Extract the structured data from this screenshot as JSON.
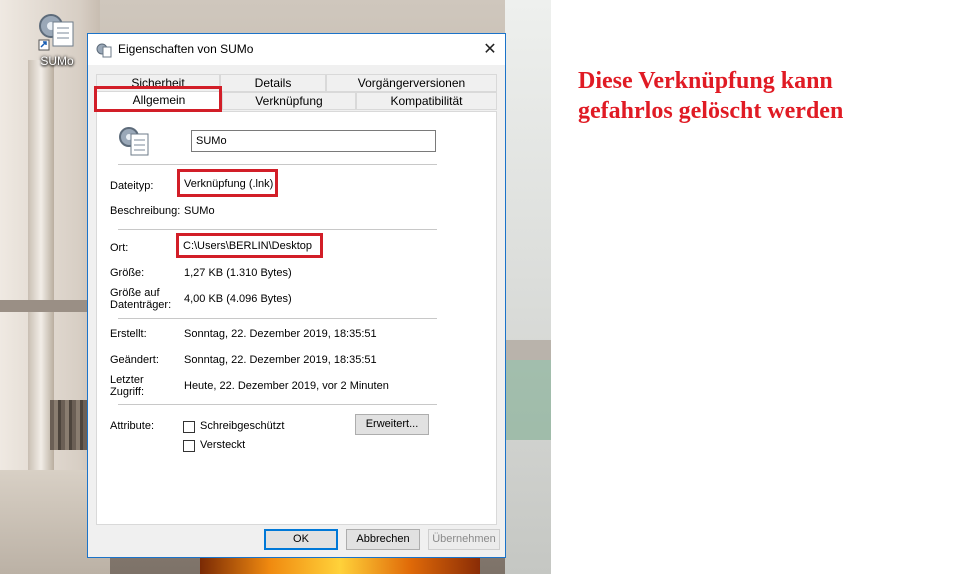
{
  "desktop": {
    "icon_label": "SUMo"
  },
  "dialog": {
    "title": "Eigenschaften von SUMo",
    "close_symbol": "✕",
    "tabs_row1": [
      "Sicherheit",
      "Details",
      "Vorgängerversionen"
    ],
    "tabs_row2": [
      "Allgemein",
      "Verknüpfung",
      "Kompatibilität"
    ],
    "selected_tab": "Allgemein",
    "name_value": "SUMo",
    "fields": {
      "dateityp_label": "Dateityp:",
      "dateityp_value": "Verknüpfung (.lnk)",
      "beschreibung_label": "Beschreibung:",
      "beschreibung_value": "SUMo",
      "ort_label": "Ort:",
      "ort_value": "C:\\Users\\BERLIN\\Desktop",
      "groesse_label": "Größe:",
      "groesse_value": "1,27 KB (1.310 Bytes)",
      "groesse_dt_label1": "Größe auf",
      "groesse_dt_label2": "Datenträger:",
      "groesse_dt_value": "4,00 KB (4.096 Bytes)",
      "erstellt_label": "Erstellt:",
      "erstellt_value": "Sonntag, 22. Dezember 2019, 18:35:51",
      "geaendert_label": "Geändert:",
      "geaendert_value": "Sonntag, 22. Dezember 2019, 18:35:51",
      "zugriff_label1": "Letzter",
      "zugriff_label2": "Zugriff:",
      "zugriff_value": "Heute, 22. Dezember 2019, vor 2 Minuten",
      "attribute_label": "Attribute:"
    },
    "attributes": {
      "schreibgeschuetzt": "Schreibgeschützt",
      "versteckt": "Versteckt",
      "erweitert_button": "Erweitert..."
    },
    "buttons": {
      "ok": "OK",
      "cancel": "Abbrechen",
      "apply": "Übernehmen"
    }
  },
  "annotation": {
    "line1": "Diese Verknüpfung kann",
    "line2": "gefahrlos gelöscht werden",
    "color": "#e01b24"
  }
}
